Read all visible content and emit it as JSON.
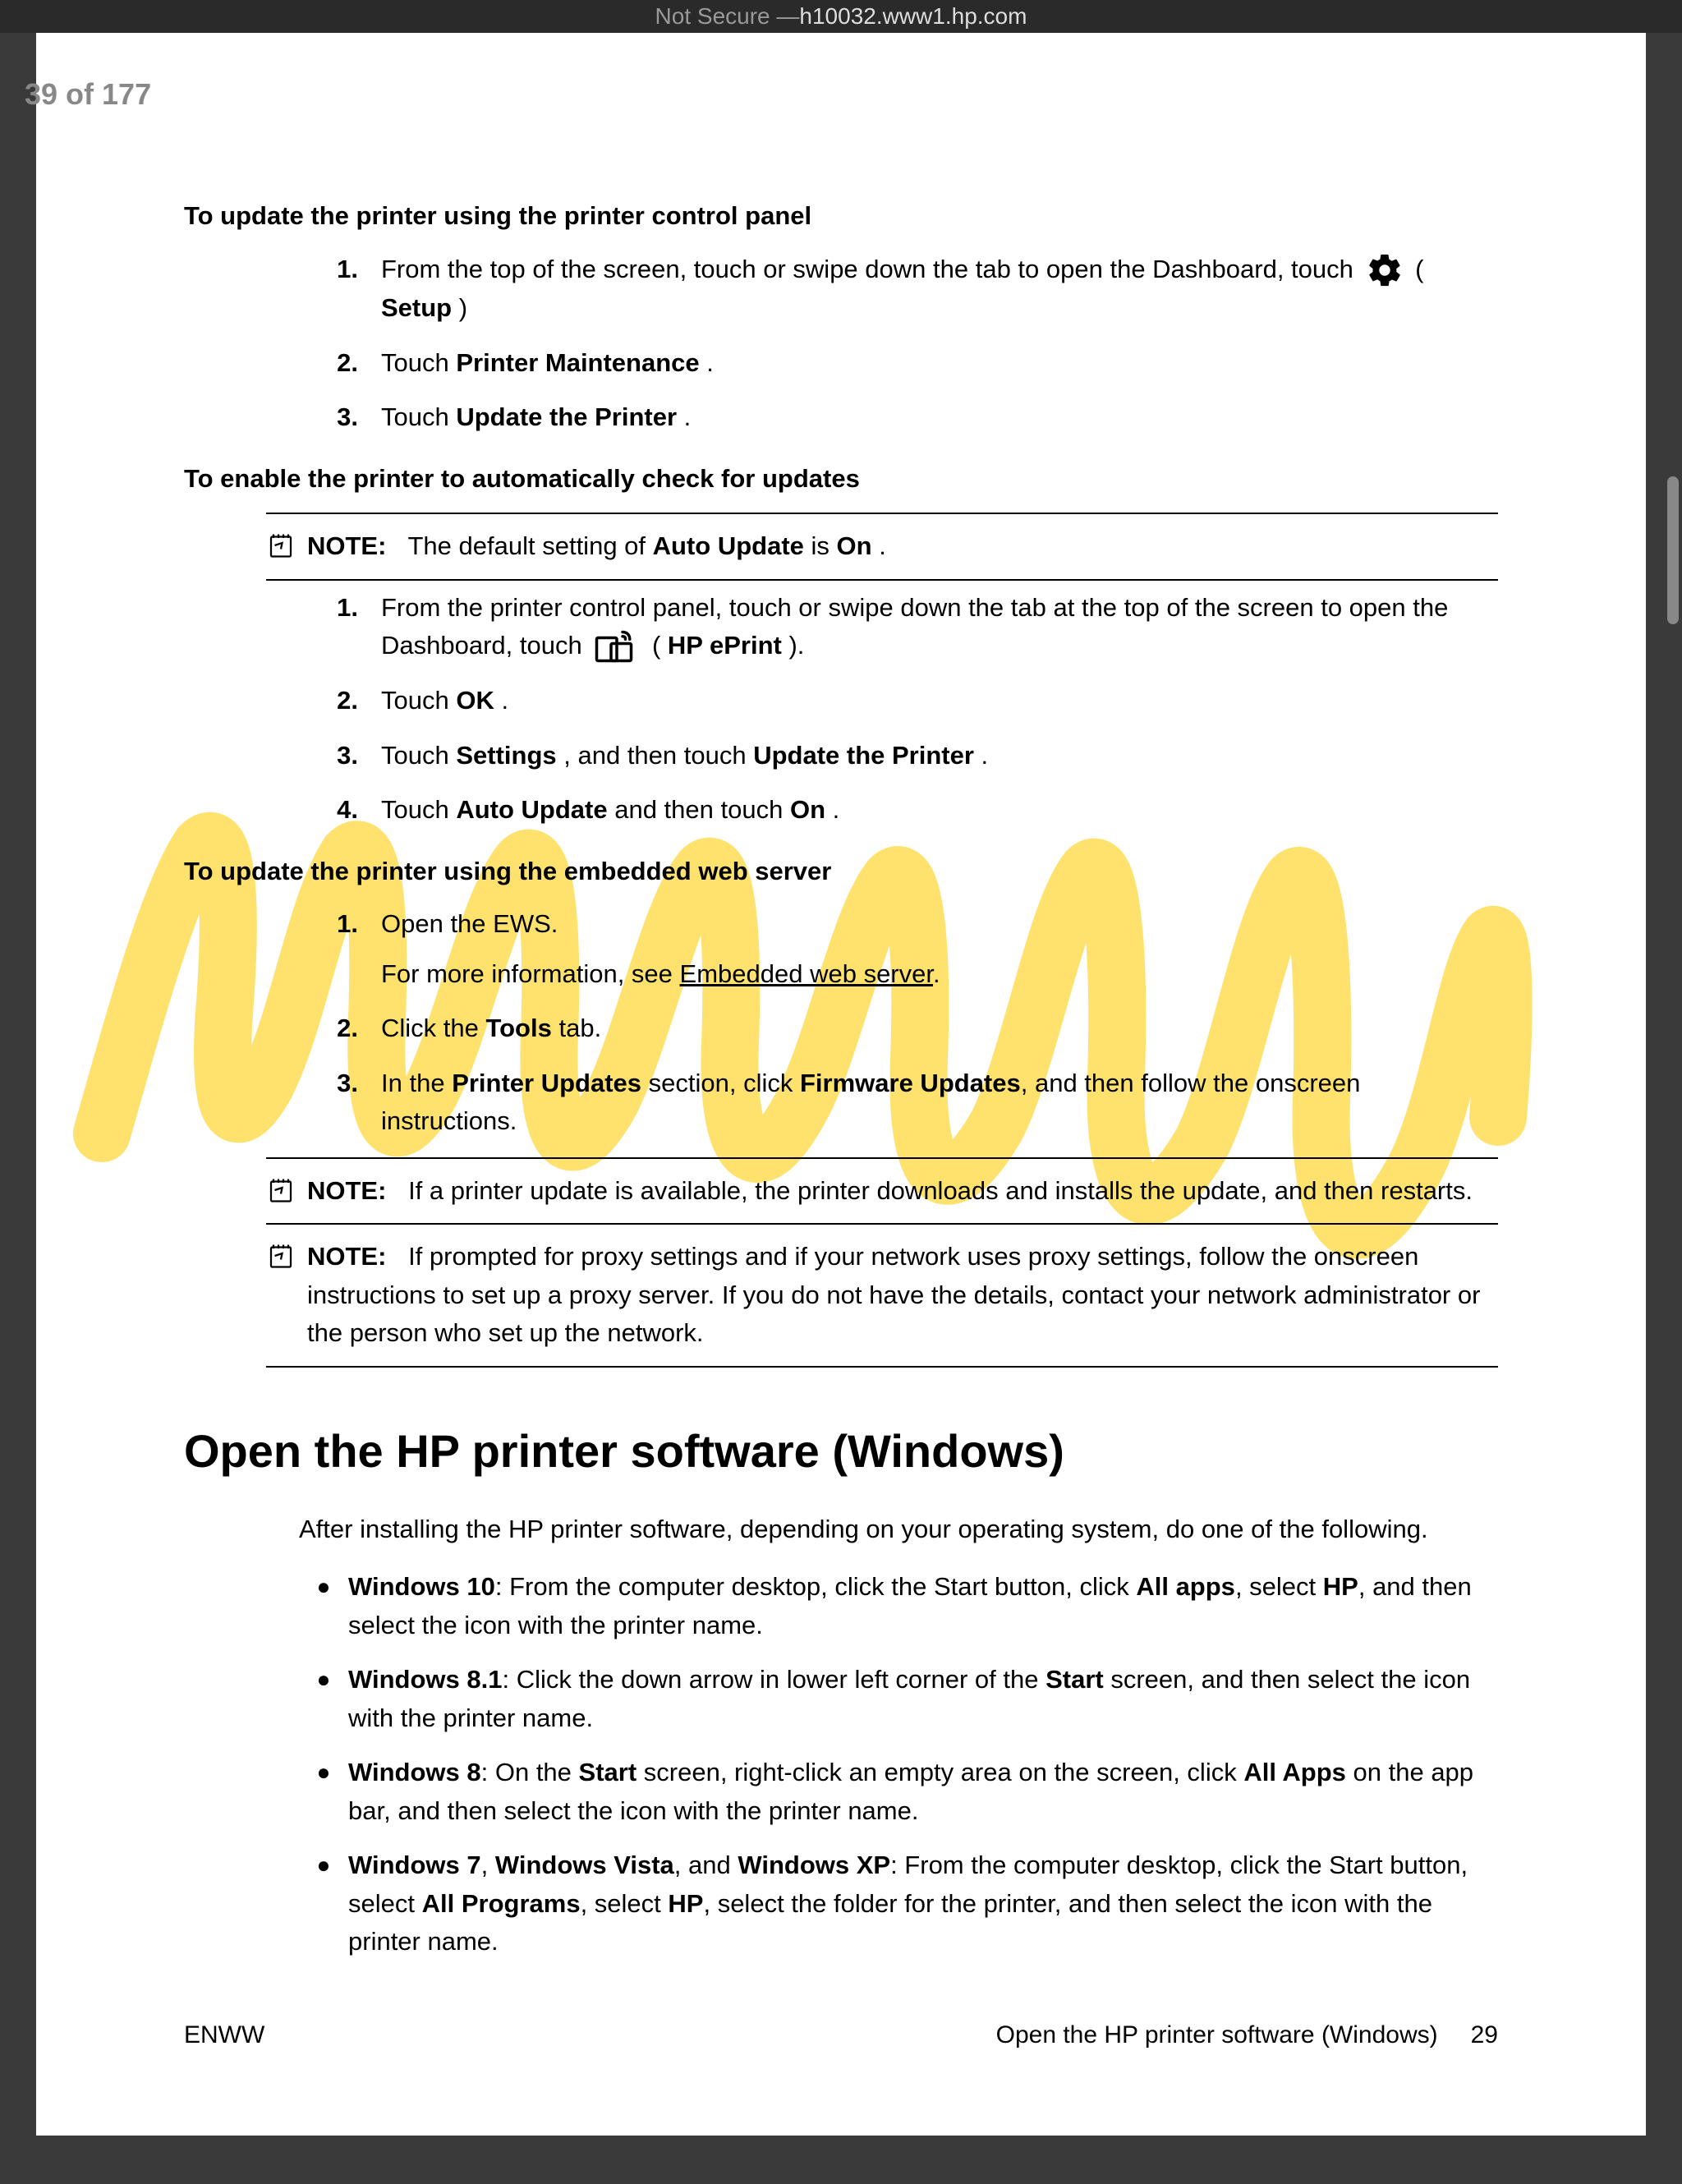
{
  "browser": {
    "security_prefix": "Not Secure — ",
    "host": "h10032.www1.hp.com"
  },
  "page_position": "39 of 177",
  "sections": {
    "s1": {
      "heading": "To update the printer using the printer control panel",
      "step1_pre": "From the top of the screen, touch or swipe down the tab to open the Dashboard, touch ",
      "step1_post1": " ( ",
      "step1_setup": "Setup",
      "step1_post2": " )",
      "step2_pre": "Touch ",
      "step2_bold": "Printer Maintenance",
      "step2_post": " .",
      "step3_pre": "Touch ",
      "step3_bold": "Update the Printer",
      "step3_post": " ."
    },
    "s2": {
      "heading": "To enable the printer to automatically check for updates",
      "note_label": "NOTE:",
      "note_pre": "The default setting of ",
      "note_b1": "Auto Update",
      "note_mid": " is ",
      "note_b2": "On",
      "note_post": " .",
      "step1_line1": "From the printer control panel, touch or swipe down the tab at the top of the screen to open the",
      "step1_line2_pre": "Dashboard, touch ",
      "step1_line2_post1": " ( ",
      "step1_line2_bold": "HP ePrint",
      "step1_line2_post2": " ).",
      "step2_pre": "Touch ",
      "step2_bold": "OK",
      "step2_post": " .",
      "step3_pre": "Touch ",
      "step3_b1": "Settings",
      "step3_mid": " , and then touch ",
      "step3_b2": "Update the Printer",
      "step3_post": " .",
      "step4_pre": "Touch ",
      "step4_b1": "Auto Update",
      "step4_mid": " and then touch ",
      "step4_b2": "On",
      "step4_post": " ."
    },
    "s3": {
      "heading": "To update the printer using the embedded web server",
      "step1_a": "Open the EWS.",
      "step1_b_pre": "For more information, see ",
      "step1_b_link": "Embedded web server",
      "step1_b_post": ".",
      "step2_pre": "Click the ",
      "step2_bold": "Tools",
      "step2_post": " tab.",
      "step3_pre": "In the ",
      "step3_b1": "Printer Updates",
      "step3_mid": " section, click ",
      "step3_b2": "Firmware Updates",
      "step3_post": ", and then follow the onscreen instructions.",
      "note1_label": "NOTE:",
      "note1_body": "If a printer update is available, the printer downloads and installs the update, and then restarts.",
      "note2_label": "NOTE:",
      "note2_body": "If prompted for proxy settings and if your network uses proxy settings, follow the onscreen instructions to set up a proxy server. If you do not have the details, contact your network administrator or the person who set up the network."
    },
    "mainheading": "Open the HP printer software (Windows)",
    "intro": "After installing the HP printer software, depending on your operating system, do one of the following.",
    "bullets": {
      "b1_w": "Windows 10",
      "b1_a": ": From the computer desktop, click the Start button, click ",
      "b1_b1": "All apps",
      "b1_b": ", select ",
      "b1_b2": "HP",
      "b1_c": ", and then select the icon with the printer name.",
      "b2_w": "Windows 8.1",
      "b2_a": ": Click the down arrow in lower left corner of the ",
      "b2_b1": "Start",
      "b2_b": " screen, and then select the icon with the printer name.",
      "b3_w": "Windows 8",
      "b3_a": ": On the ",
      "b3_b1": "Start",
      "b3_b": " screen, right-click an empty area on the screen, click ",
      "b3_b2": "All Apps",
      "b3_c": " on the app bar, and then select the icon with the printer name.",
      "b4_w1": "Windows 7",
      "b4_sep1": ", ",
      "b4_w2": "Windows Vista",
      "b4_sep2": ", and ",
      "b4_w3": "Windows XP",
      "b4_a": ": From the computer desktop, click the Start button, select ",
      "b4_b1": "All Programs",
      "b4_b": ", select ",
      "b4_b2": "HP",
      "b4_c": ", select the folder for the printer, and then select the icon with the printer name."
    },
    "footer": {
      "left": "ENWW",
      "right_title": "Open the HP printer software (Windows)",
      "page_num": "29"
    }
  }
}
